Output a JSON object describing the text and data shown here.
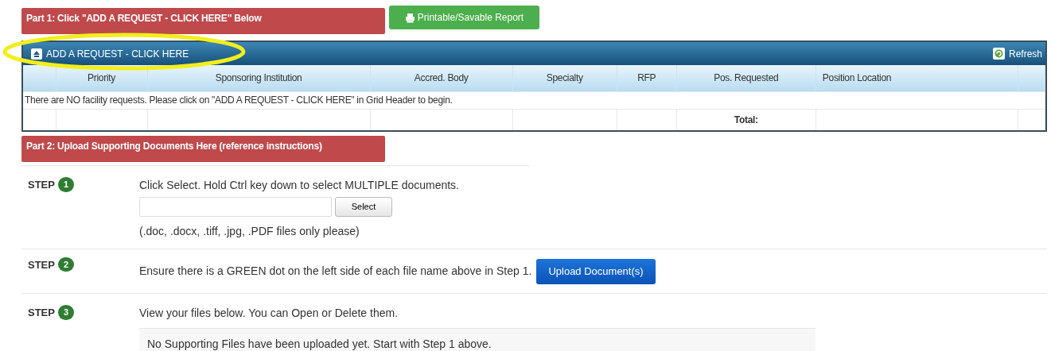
{
  "part1_banner": "Part 1: Click \"ADD A REQUEST - CLICK HERE\" Below",
  "report_button": "Printable/Savable Report",
  "grid": {
    "add_action": "ADD A REQUEST - CLICK HERE",
    "refresh": "Refresh",
    "columns": [
      "Priority",
      "Sponsoring Institution",
      "Accred. Body",
      "Specialty",
      "RFP",
      "Pos. Requested",
      "Position Location"
    ],
    "empty_message": "There are NO facility requests.  Please click on \"ADD A REQUEST - CLICK HERE\" in Grid Header to begin.",
    "total_label": "Total:"
  },
  "part2_banner": "Part 2: Upload Supporting Documents Here (reference instructions)",
  "steps": [
    {
      "kind": "select",
      "label": "STEP",
      "number": "1",
      "instruction": "Click Select. Hold Ctrl key down to select MULTIPLE documents.",
      "button": "Select",
      "note": "(.doc, .docx, .tiff, .jpg, .PDF files only please)"
    },
    {
      "kind": "upload",
      "label": "STEP",
      "number": "2",
      "instruction": "Ensure there is a GREEN dot on the left side of each file name above in Step 1.",
      "button": "Upload Document(s)"
    },
    {
      "kind": "files",
      "label": "STEP",
      "number": "3",
      "instruction": "View your files below. You can Open or Delete them.",
      "message": "No Supporting Files have been uploaded yet. Start with Step 1 above."
    }
  ]
}
